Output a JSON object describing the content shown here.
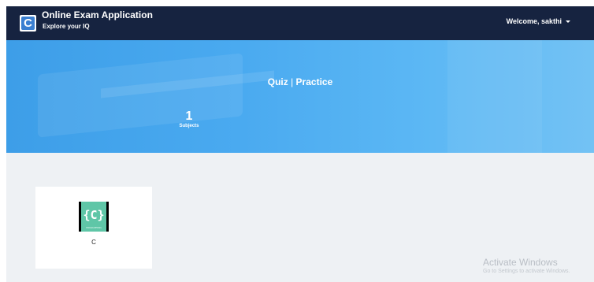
{
  "header": {
    "app_title": "Online Exam Application",
    "app_subtitle": "Explore your IQ",
    "logo_glyph": "C",
    "user_menu_label": "Welcome, sakthi"
  },
  "hero": {
    "title_bold": "Quiz",
    "title_separator": " | ",
    "title_rest": "Practice",
    "stats": {
      "count": "1",
      "label": "Subjects"
    }
  },
  "subjects": [
    {
      "logo_text": "{C}",
      "logo_caption": "PROGRAMMING",
      "label": "C",
      "logo_color": "#5fc6a7"
    }
  ],
  "watermark": {
    "title": "Activate Windows",
    "subtitle": "Go to Settings to activate Windows."
  },
  "colors": {
    "topbar": "#162340",
    "hero": "#4aaaf0",
    "background": "#eef1f4"
  }
}
